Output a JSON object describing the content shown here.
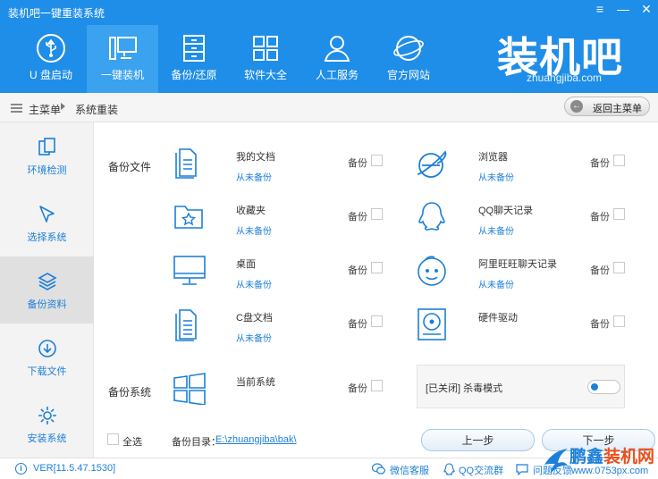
{
  "app": {
    "title": "装机吧一键重装系统",
    "brand": "装机吧",
    "brand_url": "zhuangjiba.com"
  },
  "window_controls": [
    "≡",
    "—",
    "✕"
  ],
  "nav": [
    {
      "label": "U 盘启动",
      "icon": "usb-icon"
    },
    {
      "label": "一键装机",
      "icon": "computer-icon",
      "active": true
    },
    {
      "label": "备份/还原",
      "icon": "archive-icon"
    },
    {
      "label": "软件大全",
      "icon": "grid-icon"
    },
    {
      "label": "人工服务",
      "icon": "person-icon"
    },
    {
      "label": "官方网站",
      "icon": "globe-icon"
    }
  ],
  "breadcrumb": {
    "items": [
      "主菜单",
      "系统重装"
    ],
    "back_button": "返回主菜单"
  },
  "sidebar": [
    {
      "label": "环境检测",
      "icon": "detect-icon"
    },
    {
      "label": "选择系统",
      "icon": "cursor-icon"
    },
    {
      "label": "备份资料",
      "icon": "layers-icon",
      "active": true
    },
    {
      "label": "下载文件",
      "icon": "download-icon"
    },
    {
      "label": "安装系统",
      "icon": "gear-icon"
    }
  ],
  "backup_files": {
    "section_label": "备份文件",
    "backup_label": "备份",
    "items": [
      {
        "name": "我的文档",
        "status": "从未备份",
        "icon": "document-icon"
      },
      {
        "name": "浏览器",
        "status": "从未备份",
        "icon": "ie-browser-icon"
      },
      {
        "name": "收藏夹",
        "status": "从未备份",
        "icon": "favorites-folder-icon"
      },
      {
        "name": "QQ聊天记录",
        "status": "从未备份",
        "icon": "qq-icon"
      },
      {
        "name": "桌面",
        "status": "从未备份",
        "icon": "desktop-monitor-icon"
      },
      {
        "name": "阿里旺旺聊天记录",
        "status": "从未备份",
        "icon": "wangwang-icon"
      },
      {
        "name": "C盘文档",
        "status": "从未备份",
        "icon": "c-drive-documents-icon"
      },
      {
        "name": "硬件驱动",
        "status": "",
        "icon": "hardware-driver-icon"
      }
    ]
  },
  "backup_system": {
    "section_label": "备份系统",
    "name": "当前系统",
    "icon": "windows-logo-icon",
    "backup_label": "备份"
  },
  "antivirus": {
    "label": "[已关闭] 杀毒模式",
    "enabled": false
  },
  "footer_controls": {
    "select_all": "全选",
    "dir_label": "备份目录：",
    "dir_value": "E:\\zhuangjiba\\bak\\",
    "prev_button": "上一步",
    "next_button": "下一步"
  },
  "status_bar": {
    "version": "VER[11.5.47.1530]",
    "links": [
      "微信客服",
      "QQ交流群",
      "问题反馈"
    ]
  },
  "watermark": {
    "line1_a": "鹏鑫",
    "line1_b": "装机网",
    "line2": "www.0753px.com"
  },
  "colors": {
    "header_bg": "#1f8ee8",
    "active_nav": "#3aa2ee",
    "accent": "#1c7fd9",
    "sidebar_bg": "#f3f3f3",
    "sidebar_active": "#e0e0e0"
  }
}
